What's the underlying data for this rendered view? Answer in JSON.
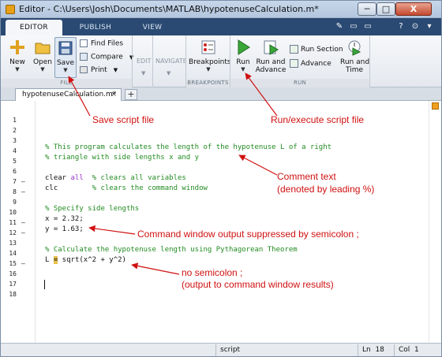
{
  "window": {
    "title": "Editor - C:\\Users\\Josh\\Documents\\MATLAB\\hypotenuseCalculation.m*",
    "min_label": "─",
    "max_label": "□",
    "close_label": "X"
  },
  "ribbon_tabs": [
    "EDITOR",
    "PUBLISH",
    "VIEW"
  ],
  "quick_access": [
    "✎",
    "▭",
    "▭",
    "?",
    "⊙",
    "▾"
  ],
  "ribbon": {
    "file": {
      "new": "New",
      "open": "Open",
      "save": "Save",
      "find_files": "Find Files",
      "compare": "Compare",
      "print": "Print",
      "group_label": "FILE"
    },
    "edit_label": "EDIT",
    "navigate_label": "NAVIGATE",
    "breakpoints": {
      "button": "Breakpoints",
      "group_label": "BREAKPOINTS"
    },
    "run": {
      "run": "Run",
      "run_and_advance": [
        "Run and",
        "Advance"
      ],
      "run_section": "Run Section",
      "advance": "Advance",
      "run_and_time": [
        "Run and",
        "Time"
      ],
      "group_label": "RUN"
    }
  },
  "document_tab": {
    "label": "hypotenuseCalculation.m*",
    "close_label": "×",
    "add_label": "+"
  },
  "code_lines": [
    {
      "n": "1",
      "dash": "",
      "text": ""
    },
    {
      "n": "2",
      "dash": "",
      "text": ""
    },
    {
      "n": "3",
      "dash": "",
      "text": ""
    },
    {
      "n": "4",
      "dash": "",
      "text": ""
    },
    {
      "n": "5",
      "dash": "",
      "text": "% This program calculates the length of the hypotenuse L of a right"
    },
    {
      "n": "6",
      "dash": "",
      "text": "% triangle with side lengths x and y"
    },
    {
      "n": "7",
      "dash": "",
      "text": ""
    },
    {
      "n": "8",
      "dash": "–",
      "text": "clear all % clears all variables"
    },
    {
      "n": "9",
      "dash": "–",
      "text": "clc       % clears the command window"
    },
    {
      "n": "10",
      "dash": "",
      "text": ""
    },
    {
      "n": "11",
      "dash": "",
      "text": "% Specify side lengths"
    },
    {
      "n": "12",
      "dash": "–",
      "text": "x = 2.32;"
    },
    {
      "n": "13",
      "dash": "–",
      "text": "y = 1.63;"
    },
    {
      "n": "14",
      "dash": "",
      "text": ""
    },
    {
      "n": "15",
      "dash": "",
      "text": "% Calculate the hypotenuse length using Pythagorean Theorem"
    },
    {
      "n": "16",
      "dash": "–",
      "text": "L = sqrt(x^2 + y^2)"
    },
    {
      "n": "17",
      "dash": "",
      "text": ""
    },
    {
      "n": "18",
      "dash": "",
      "text": ""
    }
  ],
  "code_parts": {
    "l8_kw": "clear",
    "l8_all": " all",
    "l8_cmt": "% clears all variables",
    "l9_kw": "clc",
    "l9_cmt": "% clears the command window",
    "l16_a": "L ",
    "l16_eq": "=",
    "l16_b": " sqrt(x^2 + y^2)"
  },
  "annotations": {
    "save": "Save script file",
    "run": "Run/execute script file",
    "comment_1": "Comment text",
    "comment_2": "(denoted by leading %)",
    "suppressed": "Command window output suppressed by semicolon ;",
    "no_semi_1": "no semicolon ;",
    "no_semi_2": "(output to command window results)"
  },
  "status": {
    "mode": "script",
    "ln_label": "Ln",
    "ln_value": "18",
    "col_label": "Col",
    "col_value": "1"
  },
  "colors": {
    "comment": "#228b22",
    "keyword": "#9932cc",
    "annotation": "#d01010",
    "ribbon_tabstrip": "#2a4a73"
  }
}
